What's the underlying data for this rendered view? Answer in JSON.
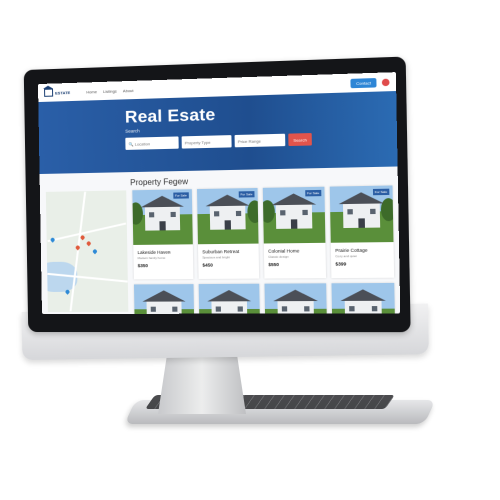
{
  "app": {
    "logo_text": "ESTATE"
  },
  "nav": [
    "Home",
    "Listings",
    "About"
  ],
  "topbar_contact": "Contact",
  "hero": {
    "title": "Real Esate",
    "subtitle": "Search"
  },
  "search": {
    "fields": [
      "Location",
      "Property Type",
      "Price Range"
    ],
    "button": "Search"
  },
  "section": {
    "title": "Property Fegew"
  },
  "listings": [
    {
      "title": "Lakeside Haven",
      "desc": "Modern family home",
      "price": "$350"
    },
    {
      "title": "Suburban Retreat",
      "desc": "Spacious and bright",
      "price": "$450"
    },
    {
      "title": "Colonial Home",
      "desc": "Classic design",
      "price": "$550"
    },
    {
      "title": "Prairie Cottage",
      "desc": "Cozy and quiet",
      "price": "$399"
    }
  ],
  "badge": "For Sale",
  "colors": {
    "hero": "#1f4e8f",
    "accent": "#e2544b",
    "button": "#2e86d6"
  }
}
